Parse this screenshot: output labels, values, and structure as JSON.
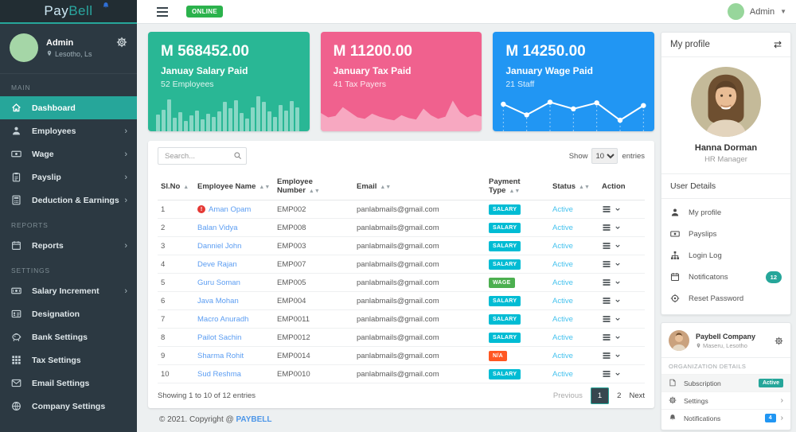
{
  "colors": {
    "accent": "#26a69a",
    "card_salary": "#29b795",
    "card_tax": "#f0618e",
    "card_wage": "#2196f3",
    "salary_badge": "#00bcd4",
    "wage_badge": "#4caf50",
    "na_badge": "#ff5722",
    "online_badge": "#2bb24c",
    "active_text": "#45c2ee",
    "pagination_active": "#37474f",
    "notif_badge": "#26a69a",
    "org_notif_badge": "#2196f3"
  },
  "brand": {
    "part1": "Pay",
    "part2": "Bell"
  },
  "topbar": {
    "online": "ONLINE",
    "user": "Admin"
  },
  "sidebar": {
    "profile": {
      "name": "Admin",
      "location": "Lesotho, Ls"
    },
    "sections": [
      {
        "label": "MAIN",
        "items": [
          {
            "icon": "home",
            "label": "Dashboard",
            "active": true,
            "arrow": false
          },
          {
            "icon": "users",
            "label": "Employees",
            "arrow": true
          },
          {
            "icon": "wage",
            "label": "Wage",
            "arrow": true
          },
          {
            "icon": "payslip",
            "label": "Payslip",
            "arrow": true
          },
          {
            "icon": "deductions",
            "label": "Deduction & Earnings",
            "arrow": true
          }
        ]
      },
      {
        "label": "REPORTS",
        "items": [
          {
            "icon": "reports",
            "label": "Reports",
            "arrow": true
          }
        ]
      },
      {
        "label": "SETTINGS",
        "items": [
          {
            "icon": "salary",
            "label": "Salary Increment",
            "arrow": true
          },
          {
            "icon": "designation",
            "label": "Designation",
            "arrow": false
          },
          {
            "icon": "bank",
            "label": "Bank Settings",
            "arrow": false
          },
          {
            "icon": "tax",
            "label": "Tax Settings",
            "arrow": false
          },
          {
            "icon": "email",
            "label": "Email Settings",
            "arrow": false
          },
          {
            "icon": "company",
            "label": "Company Settings",
            "arrow": false
          }
        ]
      }
    ]
  },
  "cards": [
    {
      "amount": "M 568452.00",
      "title": "Januay Salary Paid",
      "subtitle": "52 Employees"
    },
    {
      "amount": "M 11200.00",
      "title": "January Tax Paid",
      "subtitle": "41 Tax Payers"
    },
    {
      "amount": "M 14250.00",
      "title": "January Wage Paid",
      "subtitle": "21 Staff"
    }
  ],
  "chart_data": [
    {
      "type": "bar",
      "title": "January salary paid sparkline",
      "values": [
        48,
        62,
        92,
        40,
        56,
        30,
        46,
        60,
        36,
        52,
        42,
        58,
        86,
        66,
        90,
        54,
        38,
        70,
        100,
        84,
        58,
        42,
        76,
        60,
        88,
        70
      ]
    },
    {
      "type": "area",
      "title": "January tax paid sparkline",
      "values": [
        50,
        38,
        42,
        66,
        52,
        38,
        34,
        48,
        40,
        34,
        30,
        44,
        36,
        32,
        62,
        44,
        34,
        40,
        84,
        52,
        38,
        46,
        40
      ]
    },
    {
      "type": "line",
      "title": "January wage paid sparkline",
      "values": [
        62,
        30,
        68,
        48,
        66,
        14,
        58
      ]
    }
  ],
  "table": {
    "search_placeholder": "Search...",
    "show_label": "Show",
    "page_size": "10",
    "entries_label": "entries",
    "columns": [
      {
        "label": "Sl.No",
        "sort": "asc"
      },
      {
        "label": "Employee Name",
        "sort": "both"
      },
      {
        "label": "Employee Number",
        "sort": "both"
      },
      {
        "label": "Email",
        "sort": "both"
      },
      {
        "label": "Payment Type",
        "sort": "both"
      },
      {
        "label": "Status",
        "sort": "both"
      },
      {
        "label": "Action",
        "sort": "none"
      }
    ],
    "rows": [
      {
        "slno": "1",
        "name": "Aman Opam",
        "alert": true,
        "number": "EMP002",
        "email": "panlabmails@gmail.com",
        "payment": "SALARY",
        "ptype": "salary",
        "status": "Active"
      },
      {
        "slno": "2",
        "name": "Balan Vidya",
        "alert": false,
        "number": "EMP008",
        "email": "panlabmails@gmail.com",
        "payment": "SALARY",
        "ptype": "salary",
        "status": "Active"
      },
      {
        "slno": "3",
        "name": "Danniel John",
        "alert": false,
        "number": "EMP003",
        "email": "panlabmails@gmail.com",
        "payment": "SALARY",
        "ptype": "salary",
        "status": "Active"
      },
      {
        "slno": "4",
        "name": "Deve Rajan",
        "alert": false,
        "number": "EMP007",
        "email": "panlabmails@gmail.com",
        "payment": "SALARY",
        "ptype": "salary",
        "status": "Active"
      },
      {
        "slno": "5",
        "name": "Guru Soman",
        "alert": false,
        "number": "EMP005",
        "email": "panlabmails@gmail.com",
        "payment": "WAGE",
        "ptype": "wage",
        "status": "Active"
      },
      {
        "slno": "6",
        "name": "Java Mohan",
        "alert": false,
        "number": "EMP004",
        "email": "panlabmails@gmail.com",
        "payment": "SALARY",
        "ptype": "salary",
        "status": "Active"
      },
      {
        "slno": "7",
        "name": "Macro Anuradh",
        "alert": false,
        "number": "EMP0011",
        "email": "panlabmails@gmail.com",
        "payment": "SALARY",
        "ptype": "salary",
        "status": "Active"
      },
      {
        "slno": "8",
        "name": "Pailot Sachin",
        "alert": false,
        "number": "EMP0012",
        "email": "panlabmails@gmail.com",
        "payment": "SALARY",
        "ptype": "salary",
        "status": "Active"
      },
      {
        "slno": "9",
        "name": "Sharma Rohit",
        "alert": false,
        "number": "EMP0014",
        "email": "panlabmails@gmail.com",
        "payment": "N/A",
        "ptype": "na",
        "status": "Active"
      },
      {
        "slno": "10",
        "name": "Sud Reshma",
        "alert": false,
        "number": "EMP0010",
        "email": "panlabmails@gmail.com",
        "payment": "SALARY",
        "ptype": "salary",
        "status": "Active"
      }
    ],
    "summary": "Showing 1 to 10 of 12 entries",
    "pagination": {
      "previous": "Previous",
      "pages": [
        "1",
        "2"
      ],
      "active": "1",
      "next": "Next"
    }
  },
  "profile_panel": {
    "title": "My profile",
    "name": "Hanna Dorman",
    "role": "HR Manager",
    "section": "User Details",
    "items": [
      {
        "icon": "person",
        "label": "My profile"
      },
      {
        "icon": "money",
        "label": "Payslips"
      },
      {
        "icon": "sitemap",
        "label": "Login Log"
      },
      {
        "icon": "calendar",
        "label": "Notificatons",
        "badge": "12"
      },
      {
        "icon": "target",
        "label": "Reset Password"
      }
    ]
  },
  "org_panel": {
    "company": "Paybell Company",
    "location": "Maseru, Lesotho",
    "section": "ORGANIZATION DETAILS",
    "items": [
      {
        "icon": "subscription",
        "label": "Subscription",
        "badge": "Active",
        "badge_color": "#26a69a",
        "highlight": true,
        "arrow": false
      },
      {
        "icon": "gear",
        "label": "Settings",
        "arrow": true
      },
      {
        "icon": "bell",
        "label": "Notifications",
        "badge": "4",
        "badge_color": "#2196f3",
        "arrow": true
      }
    ]
  },
  "footer": {
    "text": "© 2021. Copyright @",
    "brand": "PAYBELL"
  }
}
